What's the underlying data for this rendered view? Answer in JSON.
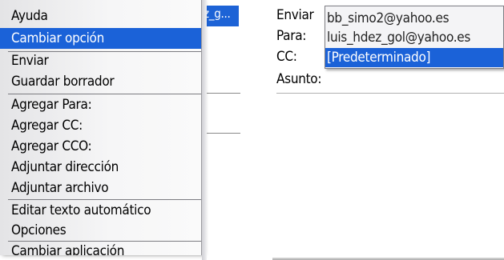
{
  "left_screen": {
    "background_hint": "z_g...",
    "menu": {
      "items": [
        {
          "label": "Ayuda",
          "selected": false
        },
        {
          "label": "Cambiar opción",
          "selected": true
        },
        {
          "label": "Enviar",
          "selected": false
        },
        {
          "label": "Guardar borrador",
          "selected": false
        },
        {
          "label": "Agregar Para:",
          "selected": false
        },
        {
          "label": "Agregar CC:",
          "selected": false
        },
        {
          "label": "Agregar CCO:",
          "selected": false
        },
        {
          "label": "Adjuntar dirección",
          "selected": false
        },
        {
          "label": "Adjuntar archivo",
          "selected": false
        },
        {
          "label": "Editar texto automático",
          "selected": false
        },
        {
          "label": "Opciones",
          "selected": false
        },
        {
          "label": "Cambiar aplicación",
          "selected": false
        }
      ]
    }
  },
  "right_screen": {
    "fields": {
      "enviar_label": "Enviar",
      "para_label": "Para:",
      "cc_label": "CC:",
      "asunto_label": "Asunto:"
    },
    "dropdown": {
      "options": [
        {
          "label": "bb_simo2@yahoo.es",
          "selected": false
        },
        {
          "label": "luis_hdez_gol@yahoo.es",
          "selected": false
        },
        {
          "label": "[Predeterminado]",
          "selected": true
        }
      ]
    }
  },
  "colors": {
    "selection": "#1b62d8",
    "menu_background": "#f2f2f4"
  }
}
